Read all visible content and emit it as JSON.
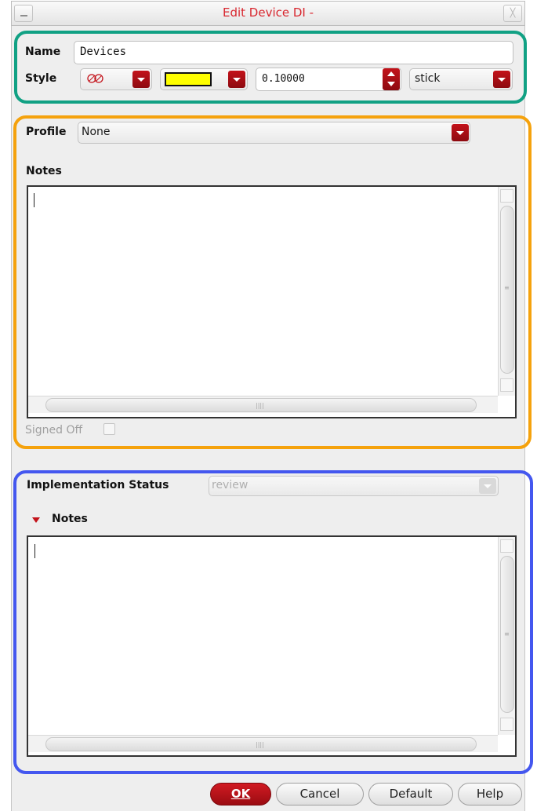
{
  "window": {
    "title": "Edit Device DI -",
    "close_glyph": "╳"
  },
  "name_row": {
    "label": "Name",
    "value": "Devices"
  },
  "style_row": {
    "label": "Style",
    "pattern_icon": "hatch-pattern-icon",
    "fill_color": "#ffff00",
    "line_width": "0.10000",
    "line_type": "stick"
  },
  "profile_section": {
    "label": "Profile",
    "value": "None",
    "notes_label": "Notes",
    "notes_text": "",
    "signed_off_label": "Signed Off",
    "signed_off_checked": false
  },
  "implementation_section": {
    "label": "Implementation Status",
    "value": "review",
    "notes_label": "Notes",
    "notes_text": ""
  },
  "buttons": {
    "ok": "OK",
    "cancel": "Cancel",
    "default": "Default",
    "help": "Help"
  },
  "colors": {
    "accent_red": "#c3121a",
    "frame_green": "#11a184",
    "frame_orange": "#f5a20d",
    "frame_blue": "#4457ef"
  }
}
